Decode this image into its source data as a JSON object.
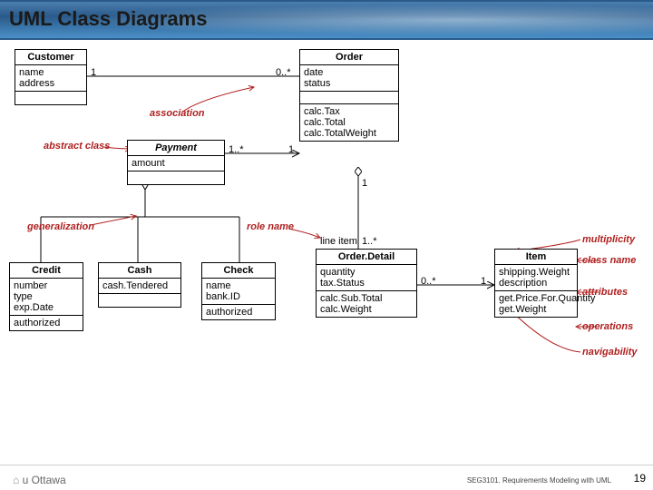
{
  "title": "UML Class Diagrams",
  "classes": {
    "customer": {
      "name": "Customer",
      "attrs": [
        "name",
        "address"
      ],
      "ops": []
    },
    "order": {
      "name": "Order",
      "attrs": [
        "date",
        "status"
      ],
      "ops": [
        "calc.Tax",
        "calc.Total",
        "calc.TotalWeight"
      ]
    },
    "payment": {
      "name": "Payment",
      "attrs": [
        "amount"
      ],
      "ops": []
    },
    "orderdetail": {
      "name": "Order.Detail",
      "attrs": [
        "quantity",
        "tax.Status"
      ],
      "ops": [
        "calc.Sub.Total",
        "calc.Weight"
      ]
    },
    "item": {
      "name": "Item",
      "attrs": [
        "shipping.Weight",
        "description"
      ],
      "ops": [
        "get.Price.For.Quantity",
        "get.Weight"
      ]
    },
    "credit": {
      "name": "Credit",
      "attrs": [
        "number",
        "type",
        "exp.Date"
      ],
      "ops": [
        "authorized"
      ]
    },
    "cash": {
      "name": "Cash",
      "attrs": [
        "cash.Tendered"
      ],
      "ops": []
    },
    "check": {
      "name": "Check",
      "attrs": [
        "name",
        "bank.ID"
      ],
      "ops": [
        "authorized"
      ]
    }
  },
  "multiplicities": {
    "cust1": "1",
    "order_many": "0..*",
    "pay_many": "1..*",
    "pay_one": "1",
    "order_one": "1",
    "line_many": "1..*",
    "detail_many": "0..*",
    "item_one": "1"
  },
  "rolename": "line item",
  "annotations": {
    "association": "association",
    "abstract": "abstract class",
    "generalization": "generalization",
    "rolename": "role name",
    "multiplicity": "multiplicity",
    "classname": "class name",
    "attributes": "attributes",
    "operations": "operations",
    "navigability": "navigability"
  },
  "footer": {
    "logo": "u Ottawa",
    "course": "SEG3101. Requirements Modeling with UML",
    "page": "19"
  }
}
